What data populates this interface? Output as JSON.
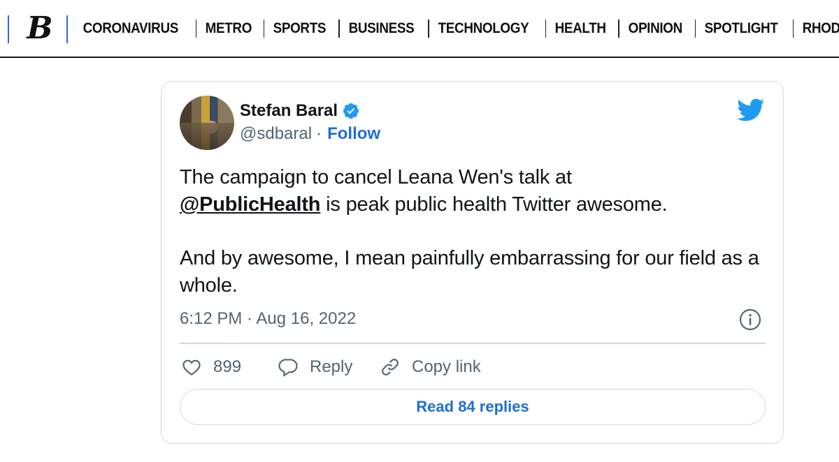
{
  "site": {
    "logo_text": "B",
    "nav": [
      "CORONAVIRUS",
      "METRO",
      "SPORTS",
      "BUSINESS",
      "TECHNOLOGY",
      "HEALTH",
      "OPINION",
      "SPOTLIGHT",
      "RHODE"
    ]
  },
  "tweet": {
    "author_name": "Stefan Baral",
    "handle": "@sdbaral",
    "separator": "·",
    "follow_label": "Follow",
    "text_line1_pre": "The campaign to cancel Leana Wen's talk at",
    "mention": "@PublicHealth",
    "text_line2_post": " is peak public health Twitter awesome.",
    "paragraph2": "And by awesome, I mean painfully embarrassing for our field as a whole.",
    "timestamp": "6:12 PM · Aug 16, 2022",
    "likes_count": "899",
    "reply_label": "Reply",
    "copy_link_label": "Copy link",
    "read_replies_label": "Read 84 replies"
  },
  "colors": {
    "accent_blue": "#1d6fd2",
    "twitter_blue": "#1d9bf0",
    "header_rule_blue": "#2f6bd1"
  },
  "icons": [
    "verified-icon",
    "twitter-bird-icon",
    "info-icon",
    "heart-icon",
    "reply-bubble-icon",
    "link-icon"
  ]
}
